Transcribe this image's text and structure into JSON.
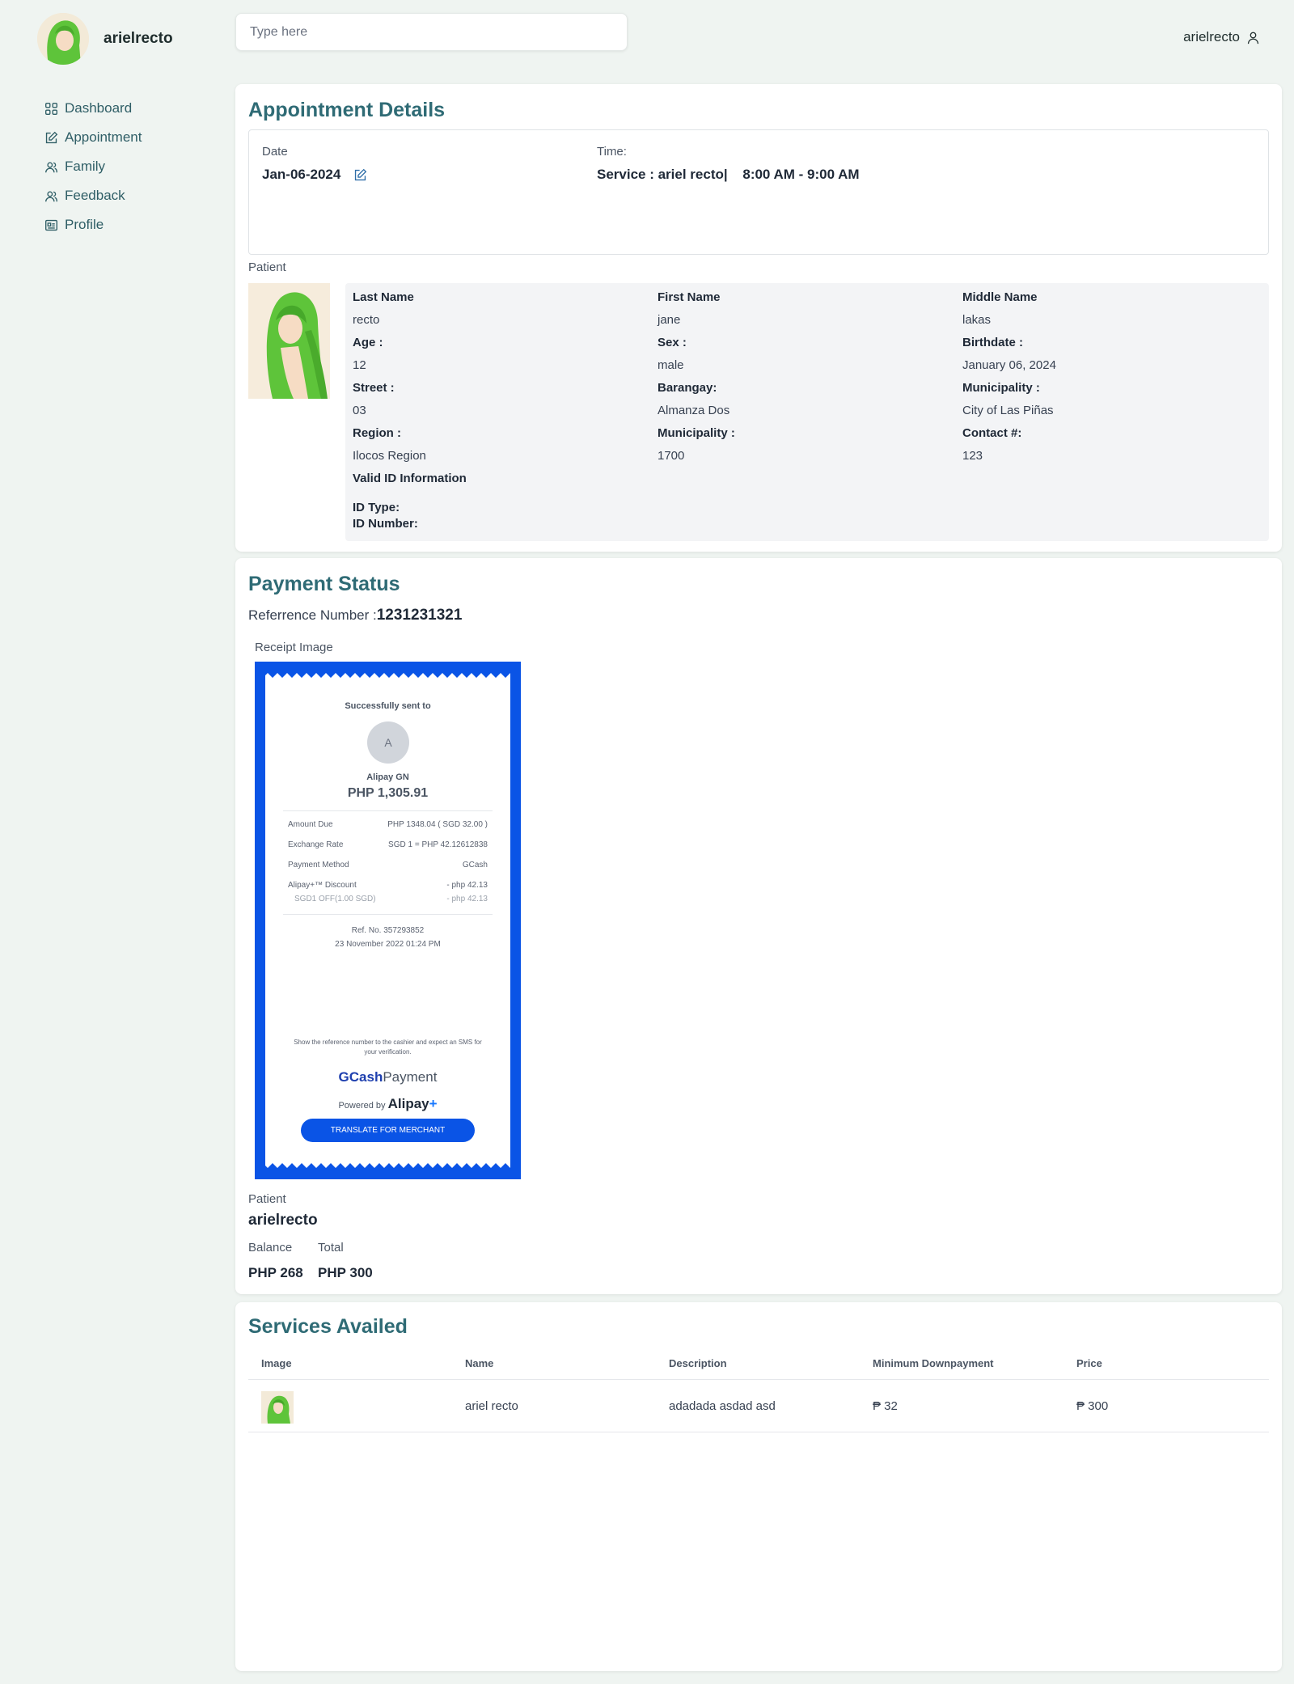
{
  "sidebar": {
    "username": "arielrecto",
    "items": [
      {
        "label": "Dashboard",
        "icon": "dashboard-icon"
      },
      {
        "label": "Appointment",
        "icon": "edit-icon"
      },
      {
        "label": "Family",
        "icon": "users-icon"
      },
      {
        "label": "Feedback",
        "icon": "users-icon"
      },
      {
        "label": "Profile",
        "icon": "id-card-icon"
      }
    ]
  },
  "header": {
    "search_placeholder": "Type here",
    "user": "arielrecto"
  },
  "appointment": {
    "title": "Appointment Details",
    "date_label": "Date",
    "date_value": "Jan-06-2024",
    "time_label": "Time:",
    "service_text": "Service : ariel recto|",
    "time_value": "8:00 AM - 9:00 AM",
    "patient_label": "Patient",
    "fields": [
      [
        {
          "k": "Last Name",
          "v": "recto"
        },
        {
          "k": "First Name",
          "v": "jane"
        },
        {
          "k": "Middle Name",
          "v": "lakas"
        }
      ],
      [
        {
          "k": "Age :",
          "v": "12"
        },
        {
          "k": "Sex :",
          "v": "male"
        },
        {
          "k": "Birthdate :",
          "v": "January 06, 2024"
        }
      ],
      [
        {
          "k": "Street :",
          "v": "03"
        },
        {
          "k": "Barangay:",
          "v": "Almanza Dos"
        },
        {
          "k": "Municipality :",
          "v": "City of Las Piñas"
        }
      ],
      [
        {
          "k": "Region :",
          "v": "Ilocos Region"
        },
        {
          "k": "Municipality :",
          "v": "1700"
        },
        {
          "k": "Contact #:",
          "v": "123"
        }
      ]
    ],
    "valid_id_title": "Valid ID Information",
    "id_type_label": "ID Type:",
    "id_number_label": "ID Number:"
  },
  "payment": {
    "title": "Payment Status",
    "ref_label": "Referrence Number :",
    "ref_value": "1231231321",
    "receipt_label": "Receipt Image",
    "receipt": {
      "sent_to": "Successfully sent to",
      "avatar_letter": "A",
      "merchant": "Alipay GN",
      "amount": "PHP 1,305.91",
      "rows": [
        {
          "k": "Amount Due",
          "v": "PHP 1348.04 ( SGD 32.00 )"
        },
        {
          "k": "Exchange Rate",
          "v": "SGD 1 = PHP 42.12612838"
        },
        {
          "k": "Payment Method",
          "v": "GCash"
        },
        {
          "k": "Alipay+™ Discount",
          "v": "- php 42.13"
        },
        {
          "k": "SGD1 OFF(1.00 SGD)",
          "v": "- php 42.13"
        }
      ],
      "ref_no": "Ref. No. 357293852",
      "datetime": "23 November 2022 01:24 PM",
      "note": "Show the reference number to the cashier and expect an SMS for your verification.",
      "gcash": "GCash",
      "payment_word": "Payment",
      "powered_by": "Powered by",
      "alipay": "Alipay",
      "translate_button": "TRANSLATE FOR MERCHANT"
    },
    "patient_label": "Patient",
    "patient_name": "arielrecto",
    "balance_label": "Balance",
    "total_label": "Total",
    "balance_value": "PHP 268",
    "total_value": "PHP 300"
  },
  "services": {
    "title": "Services Availed",
    "columns": [
      "Image",
      "Name",
      "Description",
      "Minimum Downpayment",
      "Price"
    ],
    "rows": [
      {
        "name": "ariel recto",
        "description": "adadada asdad asd",
        "downpayment": "₱ 32",
        "price": "₱ 300"
      }
    ]
  },
  "colors": {
    "accent": "#2f6b75",
    "receipt_blue": "#0a54e6",
    "background": "#eff4f1"
  }
}
